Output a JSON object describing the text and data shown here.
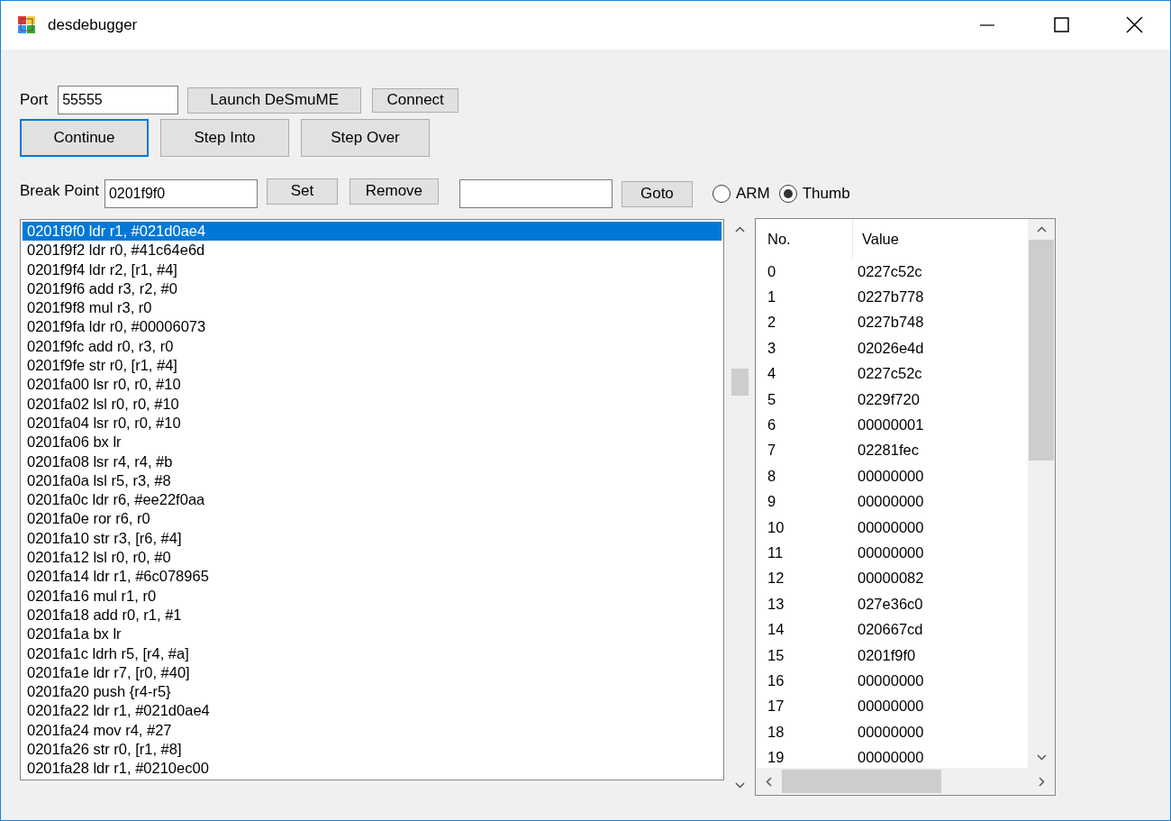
{
  "window": {
    "title": "desdebugger"
  },
  "connection": {
    "port_label": "Port",
    "port_value": "55555",
    "buttons": [
      {
        "label": "Launch DeSmuME",
        "focused": false
      },
      {
        "label": "Connect",
        "focused": false
      }
    ]
  },
  "controls": [
    {
      "label": "Continue",
      "focused": true
    },
    {
      "label": "Step Into",
      "focused": false
    },
    {
      "label": "Step Over",
      "focused": false
    }
  ],
  "breakpoint": {
    "label": "Break Point",
    "value": "0201f9f0",
    "buttons": [
      {
        "label": "Set",
        "focused": false
      },
      {
        "label": "Remove",
        "focused": false
      }
    ]
  },
  "goto": {
    "button": "Goto"
  },
  "modes": [
    {
      "label": "ARM",
      "selected": false
    },
    {
      "label": "Thumb",
      "selected": true
    }
  ],
  "disassembly": [
    {
      "text": "0201f9f0 ldr r1, #021d0ae4",
      "selected": true
    },
    {
      "text": "0201f9f2 ldr r0, #41c64e6d",
      "selected": false
    },
    {
      "text": "0201f9f4 ldr r2, [r1, #4]",
      "selected": false
    },
    {
      "text": "0201f9f6 add r3, r2, #0",
      "selected": false
    },
    {
      "text": "0201f9f8 mul r3, r0",
      "selected": false
    },
    {
      "text": "0201f9fa ldr r0, #00006073",
      "selected": false
    },
    {
      "text": "0201f9fc add r0, r3, r0",
      "selected": false
    },
    {
      "text": "0201f9fe str r0, [r1, #4]",
      "selected": false
    },
    {
      "text": "0201fa00 lsr r0, r0, #10",
      "selected": false
    },
    {
      "text": "0201fa02 lsl r0, r0, #10",
      "selected": false
    },
    {
      "text": "0201fa04 lsr r0, r0, #10",
      "selected": false
    },
    {
      "text": "0201fa06 bx lr",
      "selected": false
    },
    {
      "text": "0201fa08 lsr r4, r4, #b",
      "selected": false
    },
    {
      "text": "0201fa0a lsl r5, r3, #8",
      "selected": false
    },
    {
      "text": "0201fa0c ldr r6, #ee22f0aa",
      "selected": false
    },
    {
      "text": "0201fa0e ror r6, r0",
      "selected": false
    },
    {
      "text": "0201fa10 str r3, [r6, #4]",
      "selected": false
    },
    {
      "text": "0201fa12 lsl r0, r0, #0",
      "selected": false
    },
    {
      "text": "0201fa14 ldr r1, #6c078965",
      "selected": false
    },
    {
      "text": "0201fa16 mul r1, r0",
      "selected": false
    },
    {
      "text": "0201fa18 add r0, r1, #1",
      "selected": false
    },
    {
      "text": "0201fa1a bx lr",
      "selected": false
    },
    {
      "text": "0201fa1c ldrh r5, [r4, #a]",
      "selected": false
    },
    {
      "text": "0201fa1e ldr r7, [r0, #40]",
      "selected": false
    },
    {
      "text": "0201fa20 push {r4-r5}",
      "selected": false
    },
    {
      "text": "0201fa22 ldr r1, #021d0ae4",
      "selected": false
    },
    {
      "text": "0201fa24 mov r4, #27",
      "selected": false
    },
    {
      "text": "0201fa26 str r0, [r1, #8]",
      "selected": false
    },
    {
      "text": "0201fa28 ldr r1, #0210ec00",
      "selected": false
    }
  ],
  "registers": {
    "columns": [
      "No.",
      "Value"
    ],
    "rows": [
      [
        "0",
        "0227c52c"
      ],
      [
        "1",
        "0227b778"
      ],
      [
        "2",
        "0227b748"
      ],
      [
        "3",
        "02026e4d"
      ],
      [
        "4",
        "0227c52c"
      ],
      [
        "5",
        "0229f720"
      ],
      [
        "6",
        "00000001"
      ],
      [
        "7",
        "02281fec"
      ],
      [
        "8",
        "00000000"
      ],
      [
        "9",
        "00000000"
      ],
      [
        "10",
        "00000000"
      ],
      [
        "11",
        "00000000"
      ],
      [
        "12",
        "00000082"
      ],
      [
        "13",
        "027e36c0"
      ],
      [
        "14",
        "020667cd"
      ],
      [
        "15",
        "0201f9f0"
      ],
      [
        "16",
        "00000000"
      ],
      [
        "17",
        "00000000"
      ],
      [
        "18",
        "00000000"
      ],
      [
        "19",
        "00000000"
      ]
    ]
  }
}
